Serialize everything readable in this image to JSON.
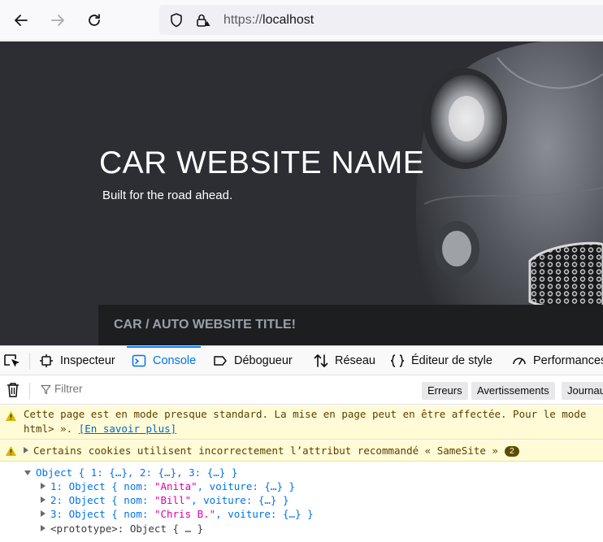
{
  "browser": {
    "url_scheme": "https://",
    "url_host": "localhost"
  },
  "hero": {
    "title": "CAR WEBSITE NAME",
    "subtitle": "Built for the road ahead.",
    "section_title": "CAR / AUTO WEBSITE TITLE!"
  },
  "devtools": {
    "tabs": [
      {
        "label": "Inspecteur",
        "icon": "inspector-icon"
      },
      {
        "label": "Console",
        "icon": "console-icon"
      },
      {
        "label": "Débogueur",
        "icon": "debugger-icon"
      },
      {
        "label": "Réseau",
        "icon": "network-icon"
      },
      {
        "label": "Éditeur de style",
        "icon": "style-editor-icon"
      },
      {
        "label": "Performances",
        "icon": "performance-icon"
      }
    ],
    "filter_placeholder": "Filtrer",
    "filter_buttons": [
      "Erreurs",
      "Avertissements",
      "Journaux"
    ],
    "messages": {
      "quirks_line1": "Cette page est en mode presque standard. La mise en page peut en être affectée. Pour le mode",
      "quirks_line2_prefix": "html> ». ",
      "quirks_link": "[En savoir plus]",
      "cookies_text": "Certains cookies utilisent incorrectement l’attribut recommandé « SameSite »",
      "cookies_count": "2"
    },
    "object_log": {
      "root": "Object { 1: {…}, 2: {…}, 3: {…} }",
      "entries": [
        {
          "prefix": "1: Object { nom: ",
          "name": "\"Anita\"",
          "suffix": ", voiture: {…} }"
        },
        {
          "prefix": "2: Object { nom: ",
          "name": "\"Bill\"",
          "suffix": ", voiture: {…} }"
        },
        {
          "prefix": "3: Object { nom: ",
          "name": "\"Chris B.\"",
          "suffix": ", voiture: {…} }"
        }
      ],
      "prototype": "<prototype>: Object { … }"
    }
  },
  "colors": {
    "hero_bg": "#2c2e33",
    "accent": "#0a84ff",
    "warning_bg": "#fffbd6"
  }
}
